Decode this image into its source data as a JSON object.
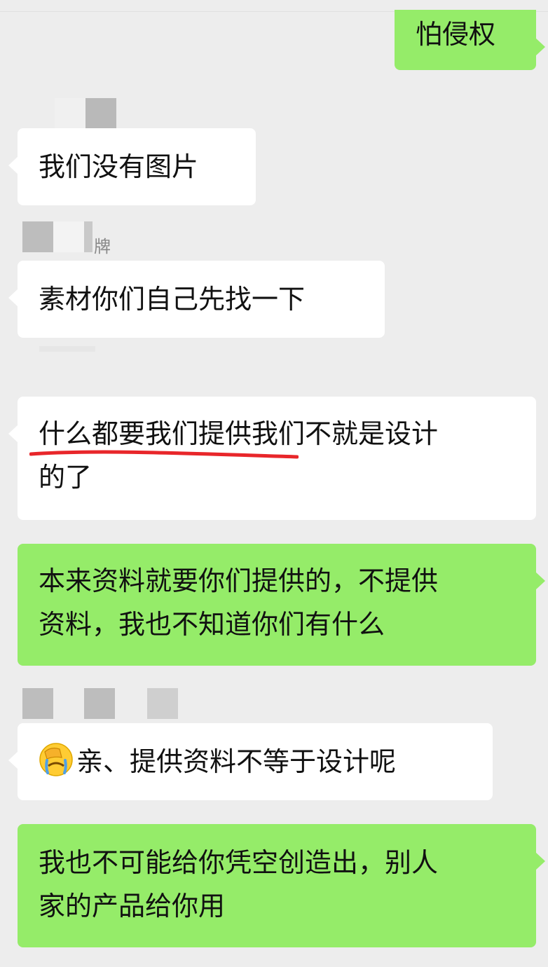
{
  "messages": [
    {
      "side": "right",
      "text": "怕侵权"
    },
    {
      "side": "left",
      "sender_fragment": "",
      "text": "我们没有图片"
    },
    {
      "side": "left",
      "sender_fragment": "牌",
      "text": "素材你们自己先找一下"
    },
    {
      "side": "left",
      "sender_fragment": "",
      "text_lines": [
        "什么都要我们提供我们不就是设计",
        "的了"
      ],
      "underlined_text": "什么都要我们提供"
    },
    {
      "side": "right",
      "text_lines": [
        "本来资料就要你们提供的，不提供",
        "资料，我也不知道你们有什么"
      ]
    },
    {
      "side": "left",
      "sender_fragment": "",
      "emoji": "face-palm-crying-emoji",
      "text": "亲、提供资料不等于设计呢"
    },
    {
      "side": "right",
      "text_lines": [
        "我也不可能给你凭空创造出，别人",
        "家的产品给你用"
      ]
    }
  ],
  "colors": {
    "background": "#ededed",
    "incoming_bubble": "#ffffff",
    "outgoing_bubble": "#95ec69",
    "annotation_underline": "#e8262a"
  }
}
